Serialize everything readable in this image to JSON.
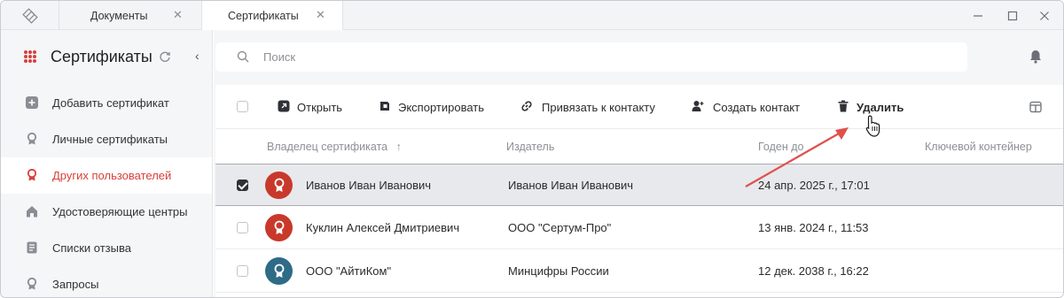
{
  "tabs": [
    {
      "label": "Документы",
      "close": "✕"
    },
    {
      "label": "Сертификаты",
      "close": "✕"
    }
  ],
  "window_controls": {
    "minimize": "—",
    "maximize": "☐",
    "close": "✕"
  },
  "sidebar": {
    "title": "Сертификаты",
    "collapse": "‹",
    "items": [
      {
        "label": "Добавить сертификат",
        "icon": "plus-square-icon"
      },
      {
        "label": "Личные сертификаты",
        "icon": "badge-icon"
      },
      {
        "label": "Других пользователей",
        "icon": "badge-icon",
        "active": true
      },
      {
        "label": "Удостоверяющие центры",
        "icon": "home-icon"
      },
      {
        "label": "Списки отзыва",
        "icon": "list-doc-icon"
      },
      {
        "label": "Запросы",
        "icon": "badge-icon"
      }
    ]
  },
  "search": {
    "placeholder": "Поиск"
  },
  "toolbar": {
    "open": "Открыть",
    "export": "Экспортировать",
    "link_contact": "Привязать к контакту",
    "create_contact": "Создать контакт",
    "delete": "Удалить"
  },
  "table": {
    "columns": {
      "owner": "Владелец сертификата",
      "sort_indicator": "↑",
      "issuer": "Издатель",
      "valid_until": "Годен до",
      "container": "Ключевой контейнер"
    },
    "rows": [
      {
        "owner": "Иванов Иван Иванович",
        "issuer": "Иванов Иван Иванович",
        "valid_until": "24 апр. 2025 г., 17:01",
        "container": "",
        "selected": true,
        "avatar_color": "#c8392b"
      },
      {
        "owner": "Куклин Алексей Дмитриевич",
        "issuer": "ООО \"Сертум-Про\"",
        "valid_until": "13 янв. 2024 г., 11:53",
        "container": "",
        "selected": false,
        "avatar_color": "#c8392b"
      },
      {
        "owner": "ООО \"АйтиКом\"",
        "issuer": "Минцифры России",
        "valid_until": "12 дек. 2038 г., 16:22",
        "container": "",
        "selected": false,
        "avatar_color": "#2e6b86"
      }
    ]
  },
  "colors": {
    "accent": "#d8403a",
    "annotation_arrow": "#e0504d"
  }
}
